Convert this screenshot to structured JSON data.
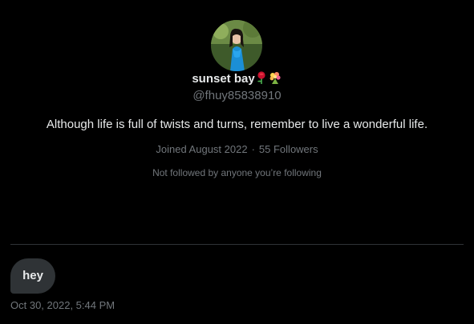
{
  "profile": {
    "display_name": "sunset bay",
    "name_emojis": [
      "rose-emoji",
      "bouquet-emoji"
    ],
    "handle": "@fhuy85838910",
    "bio": "Although life is full of twists and turns, remember to live a wonderful life.",
    "joined": "Joined August 2022",
    "separator": "·",
    "followers": "55 Followers",
    "follow_note": "Not followed by anyone you’re following"
  },
  "conversation": {
    "messages": [
      {
        "text": "hey",
        "timestamp": "Oct 30, 2022, 5:44 PM"
      }
    ]
  },
  "colors": {
    "background": "#000000",
    "primary_text": "#e7e9ea",
    "secondary_text": "#71767b",
    "bubble": "#2f3336",
    "divider": "#2f3336"
  }
}
